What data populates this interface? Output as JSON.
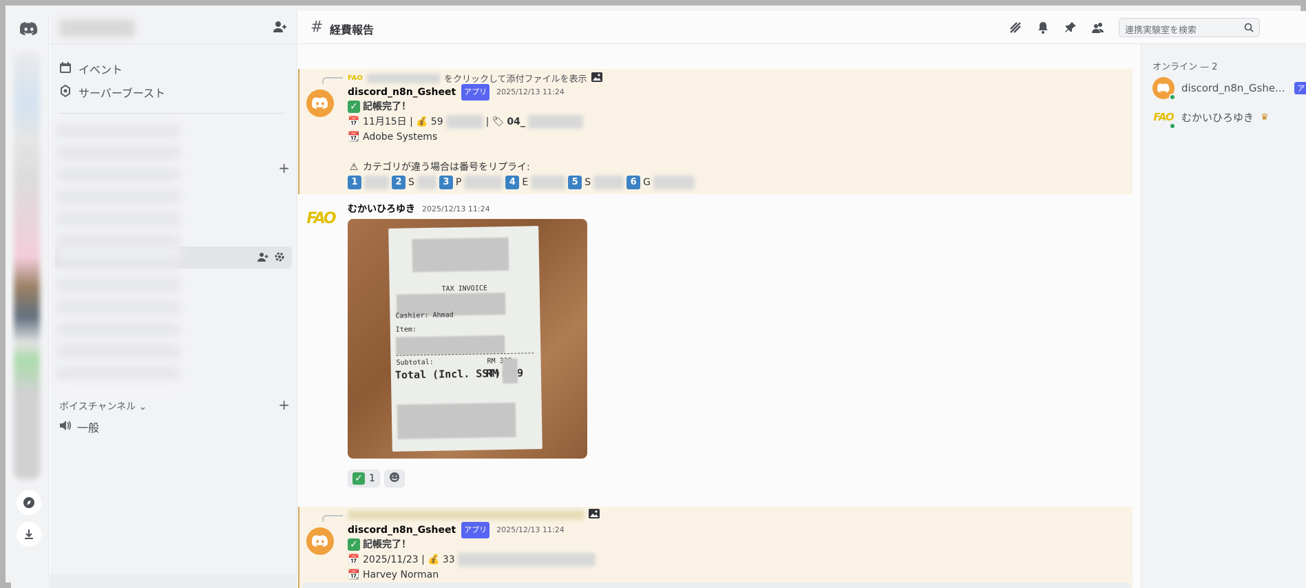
{
  "sidebar": {
    "events_label": "イベント",
    "boost_label": "サーバーブースト",
    "voice_category": "ボイスチャンネル",
    "voice_channel": "一般"
  },
  "header": {
    "channel_name": "経費報告",
    "search_placeholder": "連携実験室を検索"
  },
  "messages": [
    {
      "reply_text": "をクリックして添付ファイルを表示",
      "author": "discord_n8n_Gsheet",
      "badge": "アプリ",
      "timestamp": "2025/12/13 11:24",
      "title": "記帳完了！",
      "line1_date": "11月15日 |",
      "line1_amount": "59",
      "line1_code": "04_",
      "vendor": "Adobe Systems",
      "warning": "カテゴリが違う場合は番号をリプライ:",
      "options": [
        "1",
        "2",
        "3",
        "4",
        "5",
        "6"
      ],
      "option_letters": [
        "",
        "S",
        "P",
        "E",
        "S",
        "G"
      ]
    },
    {
      "author": "むかいひろゆき",
      "timestamp": "2025/12/13 11:24",
      "receipt_tax_invoice": "TAX INVOICE",
      "receipt_cashier": "Cashier: Ahmad",
      "receipt_item": "Item:",
      "receipt_subtotal": "Subtotal:",
      "receipt_subtotal_value": "RM 339",
      "receipt_total": "Total (Incl. SST):",
      "receipt_total_value": "RM 339",
      "reaction_count": "1"
    },
    {
      "author": "discord_n8n_Gsheet",
      "badge": "アプリ",
      "timestamp": "2025/12/13 11:24",
      "title": "記帳完了！",
      "line1_date": "2025/11/23 |",
      "line1_amount": "33",
      "vendor": "Harvey Norman"
    }
  ],
  "members": {
    "header": "オンライン — 2",
    "list": [
      {
        "name": "discord_n8n_Gshe...",
        "badge": "アプリ"
      },
      {
        "name": "むかいひろゆき"
      }
    ]
  }
}
